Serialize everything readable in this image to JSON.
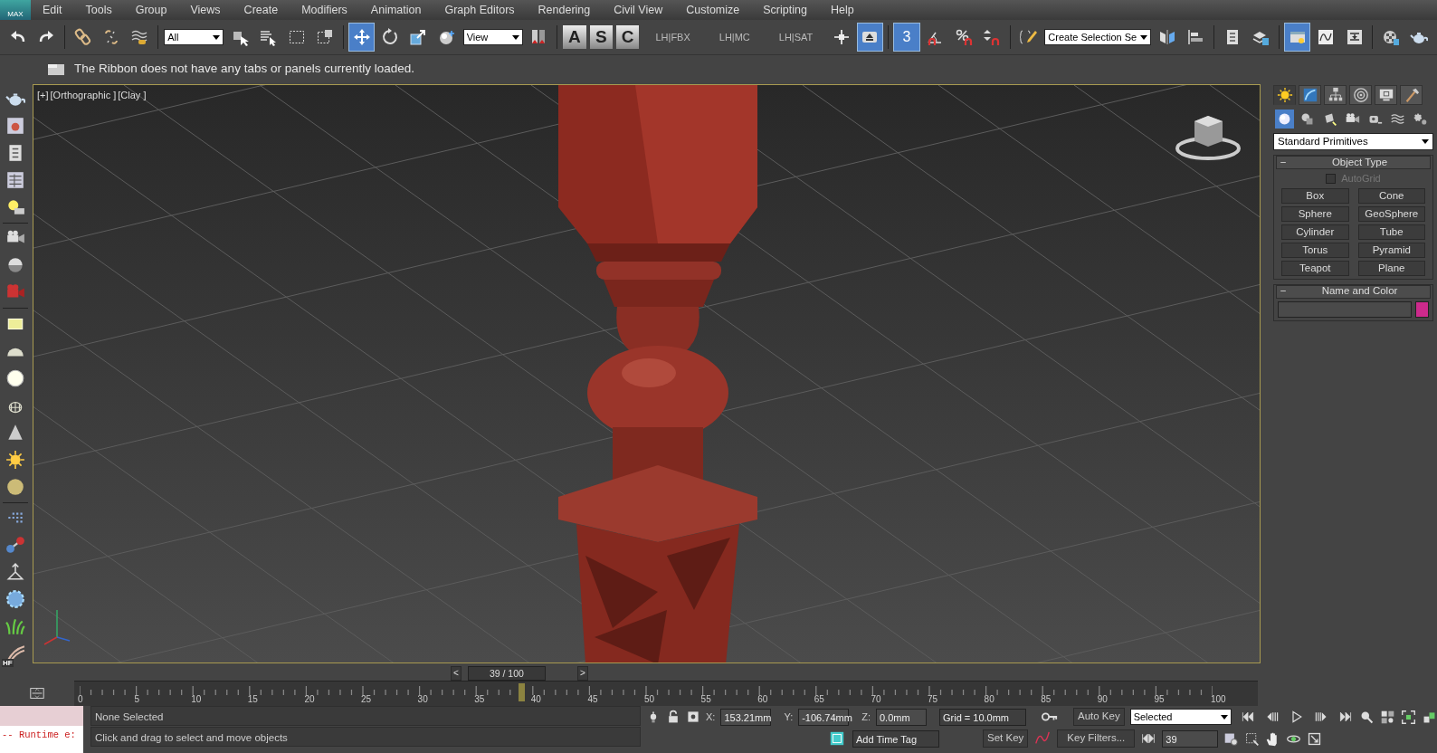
{
  "menu": {
    "logo": "MAX",
    "items": [
      "Edit",
      "Tools",
      "Group",
      "Views",
      "Create",
      "Modifiers",
      "Animation",
      "Graph Editors",
      "Rendering",
      "Civil View",
      "Customize",
      "Scripting",
      "Help"
    ]
  },
  "toolbar": [
    {
      "kind": "icon",
      "selected": false
    },
    {
      "kind": "icon",
      "selected": false
    },
    {
      "kind": "sep"
    },
    {
      "kind": "icon",
      "selected": false
    },
    {
      "kind": "icon",
      "selected": false
    },
    {
      "kind": "icon",
      "selected": false
    },
    {
      "kind": "sep"
    },
    {
      "kind": "dropdown",
      "value": "All"
    },
    {
      "kind": "icon",
      "selected": false
    },
    {
      "kind": "icon",
      "selected": false
    },
    {
      "kind": "icon",
      "selected": false
    },
    {
      "kind": "icon",
      "selected": false
    },
    {
      "kind": "sep"
    },
    {
      "kind": "icon",
      "selected": true
    },
    {
      "kind": "icon",
      "selected": false
    },
    {
      "kind": "icon",
      "selected": false
    },
    {
      "kind": "icon",
      "selected": false
    },
    {
      "kind": "dropdown",
      "value": "View"
    },
    {
      "kind": "icon",
      "selected": false
    },
    {
      "kind": "sep"
    },
    {
      "kind": "letter",
      "label": "A"
    },
    {
      "kind": "letter",
      "label": "S"
    },
    {
      "kind": "letter",
      "label": "C"
    },
    {
      "kind": "label",
      "label": "LH|FBX"
    },
    {
      "kind": "label",
      "label": "LH|MC"
    },
    {
      "kind": "label",
      "label": "LH|SAT"
    },
    {
      "kind": "icon",
      "selected": false
    },
    {
      "kind": "icon",
      "selected": true
    },
    {
      "kind": "sep"
    },
    {
      "kind": "snap",
      "label": "3",
      "selected": true
    },
    {
      "kind": "icon",
      "selected": false
    },
    {
      "kind": "icon",
      "selected": false
    },
    {
      "kind": "icon",
      "selected": false
    },
    {
      "kind": "sep"
    },
    {
      "kind": "icon",
      "selected": false
    },
    {
      "kind": "dropdown",
      "value": "Create Selection Se"
    },
    {
      "kind": "icon",
      "selected": false
    },
    {
      "kind": "icon",
      "selected": false
    },
    {
      "kind": "sep"
    },
    {
      "kind": "icon",
      "selected": false
    },
    {
      "kind": "icon",
      "selected": false
    },
    {
      "kind": "sep"
    },
    {
      "kind": "icon",
      "selected": true
    },
    {
      "kind": "icon",
      "selected": false
    },
    {
      "kind": "icon",
      "selected": false
    },
    {
      "kind": "sep"
    },
    {
      "kind": "icon",
      "selected": false
    },
    {
      "kind": "icon",
      "selected": false
    }
  ],
  "ribbon_message": "The Ribbon does not have any tabs or panels currently loaded.",
  "left_toolbar": {
    "hair_label": "HF"
  },
  "viewport": {
    "labels": [
      "[+]",
      "[Orthographic ]",
      "[Clay ]"
    ]
  },
  "command_panel": {
    "tabs": [
      {
        "selected": true
      },
      {
        "selected": false
      },
      {
        "selected": false
      },
      {
        "selected": false
      },
      {
        "selected": false
      },
      {
        "selected": false
      }
    ],
    "categories": [
      {
        "selected": true
      },
      {
        "selected": false
      },
      {
        "selected": false
      },
      {
        "selected": false
      },
      {
        "selected": false
      },
      {
        "selected": false
      },
      {
        "selected": false
      }
    ],
    "dropdown": "Standard Primitives",
    "object_type": {
      "toggle": "−",
      "title": "Object Type",
      "autogrid": {
        "label": "AutoGrid",
        "checked": false,
        "disabled": true
      },
      "buttons": [
        "Box",
        "Cone",
        "Sphere",
        "GeoSphere",
        "Cylinder",
        "Tube",
        "Torus",
        "Pyramid",
        "Teapot",
        "Plane"
      ]
    },
    "name_and_color": {
      "toggle": "−",
      "title": "Name and Color",
      "color": "#cc2a8c"
    }
  },
  "time_slider": {
    "prev": "<",
    "label": "39 / 100",
    "next": ">",
    "level": 0.39
  },
  "track": {
    "labels": [
      "0",
      "5",
      "10",
      "15",
      "20",
      "25",
      "30",
      "35",
      "40",
      "45",
      "50",
      "55",
      "60",
      "65",
      "70",
      "75",
      "80",
      "85",
      "90",
      "95",
      "100"
    ]
  },
  "listener": {
    "error": "-- Runtime e:"
  },
  "status": {
    "selection": "None Selected",
    "prompt": "Click and drag to select and move objects",
    "coords": [
      {
        "label": "X:",
        "value": "153.21mm"
      },
      {
        "label": "Y:",
        "value": "-106.74mm"
      },
      {
        "label": "Z:",
        "value": "0.0mm"
      }
    ],
    "grid": "Grid = 10.0mm",
    "time_tag": "Add Time Tag"
  },
  "keys": {
    "auto_key": "Auto Key",
    "set_key": "Set Key",
    "mode": "Selected",
    "filters": "Key Filters...",
    "frame": "39"
  }
}
